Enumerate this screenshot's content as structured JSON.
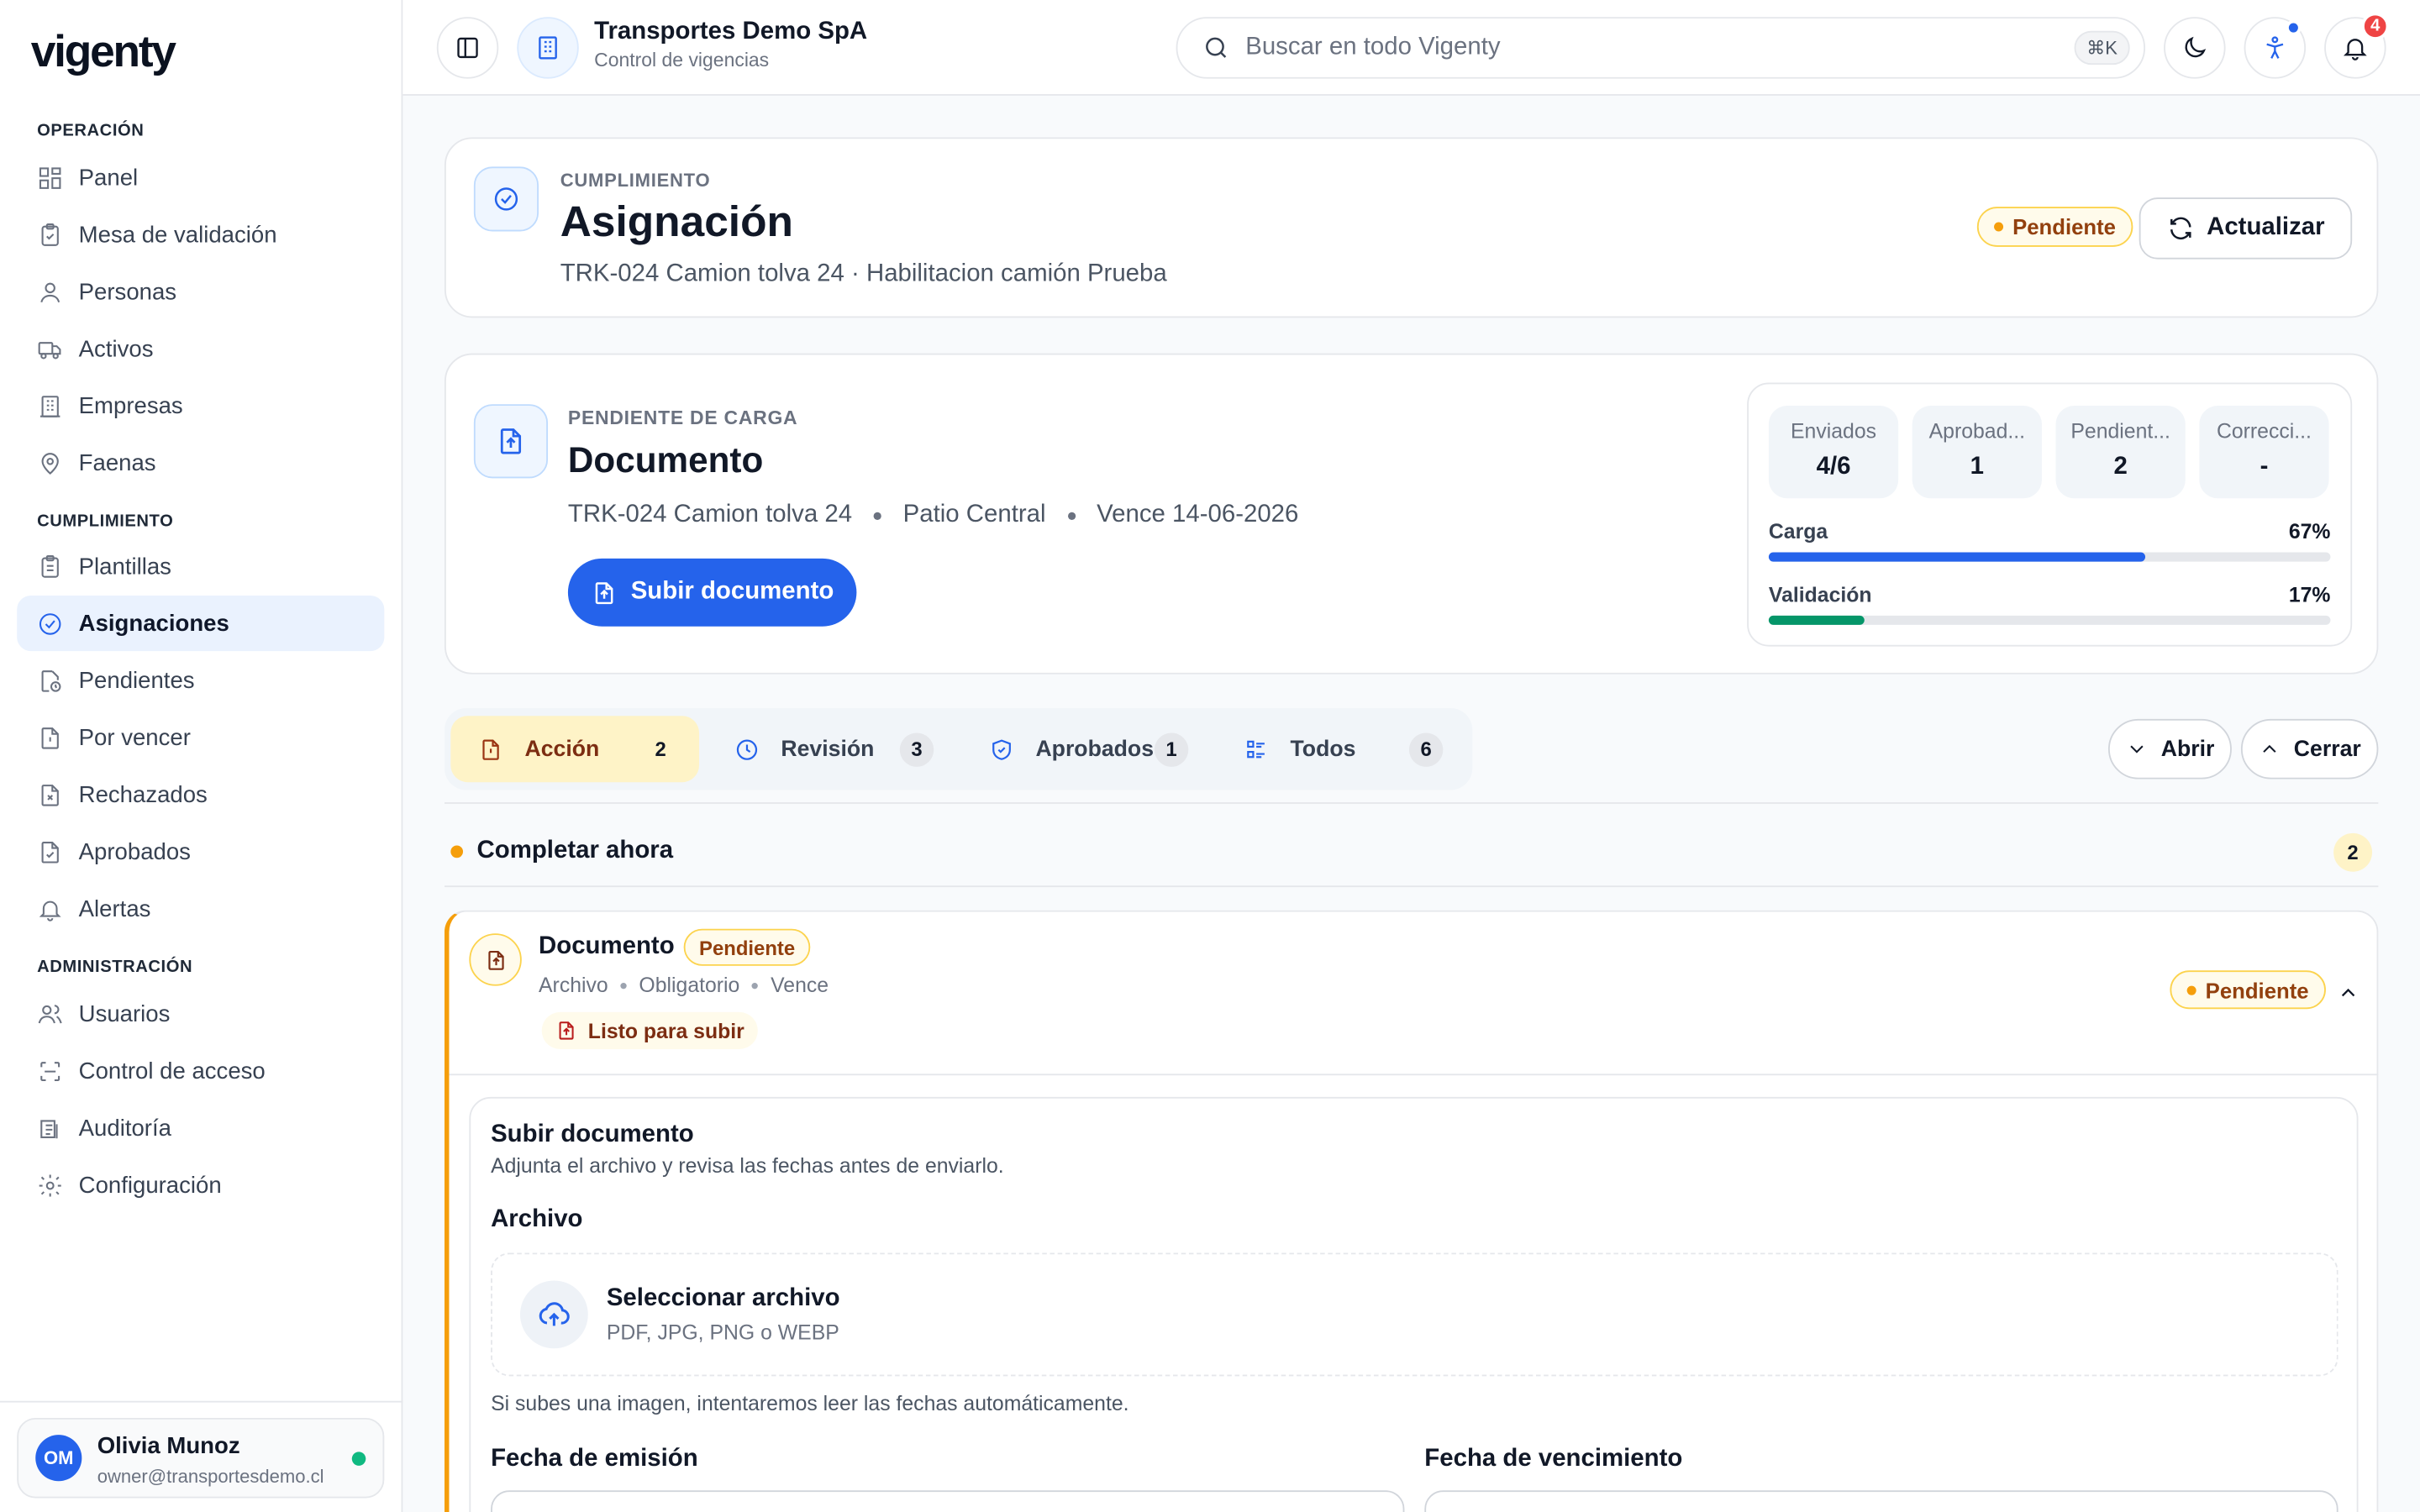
{
  "brand": "vigenty",
  "sidebar": {
    "sections": [
      {
        "title": "OPERACIÓN",
        "items": [
          {
            "label": "Panel",
            "icon": "layout-grid-icon"
          },
          {
            "label": "Mesa de validación",
            "icon": "clipboard-check-icon"
          },
          {
            "label": "Personas",
            "icon": "user-icon"
          },
          {
            "label": "Activos",
            "icon": "truck-icon"
          },
          {
            "label": "Empresas",
            "icon": "building-icon"
          },
          {
            "label": "Faenas",
            "icon": "map-pin-icon"
          }
        ]
      },
      {
        "title": "CUMPLIMIENTO",
        "items": [
          {
            "label": "Plantillas",
            "icon": "clipboard-list-icon"
          },
          {
            "label": "Asignaciones",
            "icon": "circle-check-icon",
            "active": true
          },
          {
            "label": "Pendientes",
            "icon": "file-clock-icon"
          },
          {
            "label": "Por vencer",
            "icon": "file-alert-icon"
          },
          {
            "label": "Rechazados",
            "icon": "file-x-icon"
          },
          {
            "label": "Aprobados",
            "icon": "file-check-icon"
          },
          {
            "label": "Alertas",
            "icon": "bell-icon"
          }
        ]
      },
      {
        "title": "ADMINISTRACIÓN",
        "items": [
          {
            "label": "Usuarios",
            "icon": "users-icon"
          },
          {
            "label": "Control de acceso",
            "icon": "scan-icon"
          },
          {
            "label": "Auditoría",
            "icon": "audit-list-icon"
          },
          {
            "label": "Configuración",
            "icon": "settings-icon"
          }
        ]
      }
    ],
    "user": {
      "initials": "OM",
      "name": "Olivia Munoz",
      "email": "owner@transportesdemo.cl"
    }
  },
  "topbar": {
    "org": "Transportes Demo SpA",
    "org_sub": "Control de vigencias",
    "search_placeholder": "Buscar en todo Vigenty",
    "shortcut": "⌘K",
    "notif_count": "4"
  },
  "header": {
    "eyebrow": "CUMPLIMIENTO",
    "title": "Asignación",
    "subtitle": "TRK-024 Camion tolva 24 · Habilitacion camión Prueba",
    "status": "Pendiente",
    "refresh": "Actualizar"
  },
  "doc": {
    "eyebrow": "PENDIENTE DE CARGA",
    "title": "Documento",
    "meta": [
      "TRK-024 Camion tolva 24",
      "Patio Central",
      "Vence 14-06-2026"
    ],
    "button": "Subir documento",
    "stats": [
      {
        "label": "Enviados",
        "value": "4/6"
      },
      {
        "label": "Aprobad...",
        "value": "1"
      },
      {
        "label": "Pendient...",
        "value": "2"
      },
      {
        "label": "Correcci...",
        "value": "-"
      }
    ],
    "progress": [
      {
        "label": "Carga",
        "percent_text": "67%",
        "value": 0.67,
        "color": "#2563eb"
      },
      {
        "label": "Validación",
        "percent_text": "17%",
        "value": 0.17,
        "color": "#059669"
      }
    ]
  },
  "tabs": [
    {
      "label": "Acción",
      "count": "2"
    },
    {
      "label": "Revisión",
      "count": "3"
    },
    {
      "label": "Aprobados",
      "count": "1"
    },
    {
      "label": "Todos",
      "count": "6"
    }
  ],
  "toggles": {
    "open": "Abrir",
    "close": "Cerrar"
  },
  "group": {
    "title": "Completar ahora",
    "count": "2"
  },
  "item": {
    "title": "Documento",
    "tag": "Pendiente",
    "meta": [
      "Archivo",
      "Obligatorio",
      "Vence"
    ],
    "ready": "Listo para subir",
    "status": "Pendiente"
  },
  "upload": {
    "title": "Subir documento",
    "desc": "Adjunta el archivo y revisa las fechas antes de enviarlo.",
    "file_label": "Archivo",
    "select": "Seleccionar archivo",
    "formats": "PDF, JPG, PNG o WEBP",
    "hint": "Si subes una imagen, intentaremos leer las fechas automáticamente.",
    "issue_label": "Fecha de emisión",
    "expiry_label": "Fecha de vencimiento"
  },
  "colors": {
    "accent": "#2563eb",
    "active_bg": "#eaf2fe",
    "pending": "#f59e0b",
    "success": "#059669"
  }
}
